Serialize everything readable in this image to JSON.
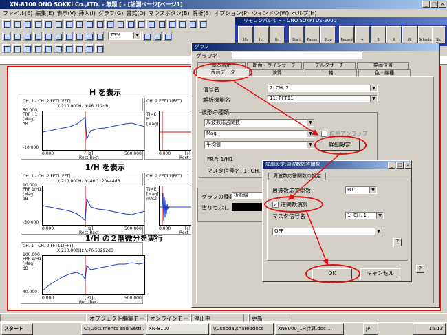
{
  "window": {
    "title": "XN-8100 ONO SOKKI Co.,LTD. - 無題 [ - [計測ページ[ページ1]"
  },
  "menu": [
    "ファイル(E)",
    "編集(E)",
    "表示(V)",
    "挿入(I)",
    "グラフ(G)",
    "書式(O)",
    "マウスボタン(B)",
    "解析(S)",
    "オプション(P)",
    "ウィンドウ(W)",
    "ヘルプ(H)"
  ],
  "zoom": "75%",
  "remote": {
    "title": "リモコンパレット - ONO SOKKI DS-2000",
    "buttons": [
      "Hn",
      "Hn",
      "Hn",
      "Start",
      "Pause",
      "Stop",
      "Record",
      "+",
      "S",
      "X",
      "N",
      "Schedule",
      "Sig Out"
    ]
  },
  "sheet": {
    "annotations": [
      "H を表示",
      "1/H を表示",
      "1/H の２階微分を実行"
    ],
    "panels": [
      {
        "head": "CH. 1 - CH. 2  FFT1(FFT)",
        "info": "X:210.000Hz    Y:46.212dB",
        "ylab": "FRF H1\n[Mag]\ndB",
        "y1": "50.000",
        "y2": "-10.000",
        "x1": "0.000",
        "x2": "500.000",
        "xl": "[Hz]",
        "xl2": "Rect-Rect"
      },
      {
        "head": "CH. 2  FFT11(FFT)",
        "info": "",
        "ylab": "TIME\nH1\n[Mag]",
        "y1": "",
        "y2": "",
        "x1": "0.000",
        "x2": "",
        "xl": "[s]",
        "xl2": "Rect"
      },
      {
        "head": "CH. 1 - CH. 2  FFT1(FFT)",
        "info": "X:210.000Hz    Y:-46.1120e44dB",
        "ylab": "FRF 1/H1\n[Mag]\ndB",
        "y1": "10.000",
        "y2": "-50.000",
        "x1": "0.000",
        "x2": "500.000",
        "xl": "[Hz]",
        "xl2": "Rect-Rect"
      },
      {
        "head": "CH. 2  FFT11(FFT)",
        "info": "",
        "ylab": "TIME\n[Mag]\nm/s2",
        "y1": "",
        "y2": "",
        "x1": "0.000",
        "x2": "",
        "xl": "[s]",
        "xl2": "Rect"
      },
      {
        "head": "CH. 1 - CH. 2  FFT11(FFT)",
        "info": "X:210.000Hz    Y:76.50292dB",
        "ylab": "FRF 1/H1\n[Mag]\ndB",
        "y1": "100.000",
        "y2": "40.000",
        "x1": "0.000",
        "x2": "500.000",
        "xl": "[Hz]",
        "xl2": "Rect-Rect"
      }
    ]
  },
  "dialog": {
    "title": "グラフ",
    "graph_name_label": "グラフ名",
    "tabs_top": [
      "基本表示",
      "断面・ラインサーチ",
      "デルタサーチ",
      "描画位置"
    ],
    "tabs_bottom": [
      "表示データ",
      "演算",
      "軸",
      "色・線種"
    ],
    "signal_label": "信号名",
    "signal_value": "2: CH. 2",
    "func_label": "解析機能名",
    "func_value": "11: FFT11",
    "wave_group": "波形の種類",
    "wave1": "周波数応答関数",
    "wave2": "Mag",
    "wave3": "平均値",
    "phase_label": "位相アンラップ",
    "detail_button": "詳細設定",
    "frf_label": "FRF: 1/H1",
    "master_label": "マスタ信号名: 1: CH. 1",
    "graph_type_label": "グラフの種類",
    "graph_type_value": "折れ線",
    "fill_label": "塗りつぶし",
    "help": "?"
  },
  "sub": {
    "title": "詳細設定:周波数応答関数",
    "tab": "周波数応答関数の設定",
    "frf_label": "周波数応答関数",
    "frf_value": "H1",
    "inverse_label": "逆関数演算",
    "inverse_checked": "✓",
    "master_label": "マスタ信号名",
    "master_value": "1: CH. 1",
    "off_value": "OFF",
    "ok": "OK",
    "cancel": "キャンセル",
    "help": "?"
  },
  "status": [
    "オブジェクト編集モード",
    "オンラインモード",
    "停止中",
    "",
    "更新"
  ],
  "taskbar": {
    "start": "スタート",
    "items": [
      "C:\\Documents and Setti...",
      "XN-8100",
      "\\\\Csnoda\\shareddocs",
      "XN8000_1H計算.doc ...",
      "JP"
    ],
    "clock": "16:13"
  },
  "colors": {
    "titlebar": "#0a246a",
    "accent": "#e01010",
    "remote": "#2a3cac"
  }
}
